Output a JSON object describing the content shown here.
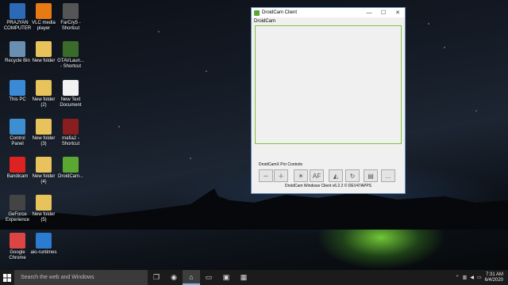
{
  "desktop_icons": [
    {
      "label": "PRAJYAN\nCOMPUTER",
      "icon": "computer-icon"
    },
    {
      "label": "VLC media\nplayer",
      "icon": "vlc-icon"
    },
    {
      "label": "FarCry5 -\nShortcut",
      "icon": "farcry5-icon"
    },
    {
      "label": "Recycle Bin",
      "icon": "recycle-bin-icon"
    },
    {
      "label": "New folder",
      "icon": "folder-icon"
    },
    {
      "label": "GTAVLaun...\n- Shortcut",
      "icon": "gtav-icon"
    },
    {
      "label": "This PC",
      "icon": "this-pc-icon"
    },
    {
      "label": "New folder\n(2)",
      "icon": "folder-icon"
    },
    {
      "label": "New Text\nDocument",
      "icon": "text-document-icon"
    },
    {
      "label": "Control\nPanel",
      "icon": "control-panel-icon"
    },
    {
      "label": "New folder\n(3)",
      "icon": "folder-icon"
    },
    {
      "label": "mafia2 -\nShortcut",
      "icon": "mafia2-icon"
    },
    {
      "label": "Bandicam",
      "icon": "bandicam-icon"
    },
    {
      "label": "New folder\n(4)",
      "icon": "folder-icon"
    },
    {
      "label": "DroidCam...",
      "icon": "droidcam-icon"
    },
    {
      "label": "GeForce\nExperience",
      "icon": "geforce-icon"
    },
    {
      "label": "New folder\n(5)",
      "icon": "folder-icon"
    },
    {
      "label": "Google\nChrome",
      "icon": "chrome-icon"
    },
    {
      "label": "aio-runtimes",
      "icon": "aio-runtimes-icon"
    }
  ],
  "window": {
    "title": "DroidCam Client",
    "menu_label": "DroidCam",
    "pro_controls_label": "DroidCamX Pro Controls",
    "status_text": "DroidCam Windows Client v6.2.2 © DEV47APPS",
    "minimize": "—",
    "maximize": "☐",
    "close": "✕",
    "tools": [
      {
        "icon": "zoom-out-icon",
        "glyph": "－"
      },
      {
        "icon": "zoom-in-icon",
        "glyph": "＋"
      },
      {
        "icon": "flash-icon",
        "glyph": "☀"
      },
      {
        "icon": "autofocus-icon",
        "glyph": "AF"
      },
      {
        "icon": "mirror-icon",
        "glyph": "◭"
      },
      {
        "icon": "rotate-icon",
        "glyph": "↻"
      },
      {
        "icon": "save-picture-icon",
        "glyph": "▤"
      },
      {
        "icon": "more-options-icon",
        "glyph": "…"
      }
    ]
  },
  "taskbar": {
    "search_placeholder": "Search the web and Windows",
    "time": "7:31 AM",
    "date": "6/4/2020",
    "apps": [
      {
        "icon": "task-view-icon",
        "glyph": "❐",
        "active": false
      },
      {
        "icon": "chrome-taskbar-icon",
        "glyph": "◉",
        "active": false
      },
      {
        "icon": "droidcam-taskbar-icon",
        "glyph": "⌂",
        "active": true
      },
      {
        "icon": "file-explorer-icon",
        "glyph": "▭",
        "active": false
      },
      {
        "icon": "store-icon",
        "glyph": "▣",
        "active": false
      },
      {
        "icon": "pinned-app-icon",
        "glyph": "▦",
        "active": false
      }
    ]
  }
}
